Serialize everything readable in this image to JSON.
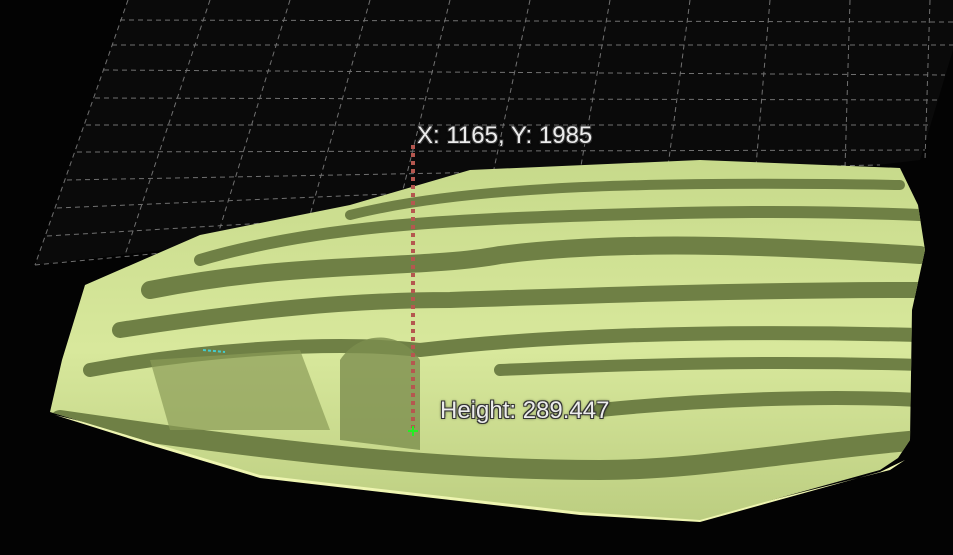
{
  "viewer": {
    "coordinate_readout": "X: 1165, Y: 1985",
    "height_readout": "Height: 289.447"
  },
  "colors": {
    "background": "#030303",
    "grid_line": "#8a8a8a",
    "terrain_light": "#eef5b0",
    "terrain_dark": "#6f8045",
    "probe_line": "#b5574f",
    "probe_marker": "#22ee22"
  }
}
